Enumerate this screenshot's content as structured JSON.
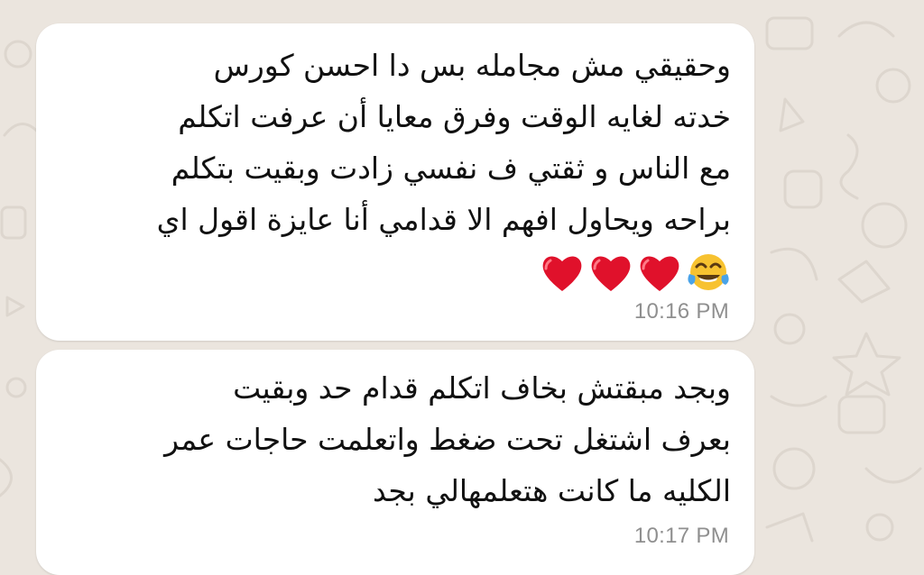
{
  "messages": [
    {
      "lines": [
        "وحقيقي مش مجامله بس دا احسن كورس",
        "خدته لغايه الوقت وفرق معايا أن عرفت اتكلم",
        "مع الناس و ثقتي ف نفسي زادت وبقيت بتكلم",
        "براحه ويحاول افهم الا قدامي أنا عايزة اقول اي"
      ],
      "emojis": [
        "heart-icon",
        "heart-icon",
        "heart-icon",
        "tears-of-joy-icon"
      ],
      "time": "10:16 PM"
    },
    {
      "lines": [
        "وبجد مبقتش بخاف اتكلم قدام حد وبقيت",
        "بعرف اشتغل تحت ضغط واتعلمت حاجات عمر",
        "الكليه ما كانت هتعلمهالي بجد"
      ],
      "time": "10:17 PM"
    }
  ],
  "colors": {
    "wallpaper": "#ebe5de",
    "bubble": "#ffffff",
    "heart": "#e0112b",
    "timestamp": "#8f8f8f"
  }
}
